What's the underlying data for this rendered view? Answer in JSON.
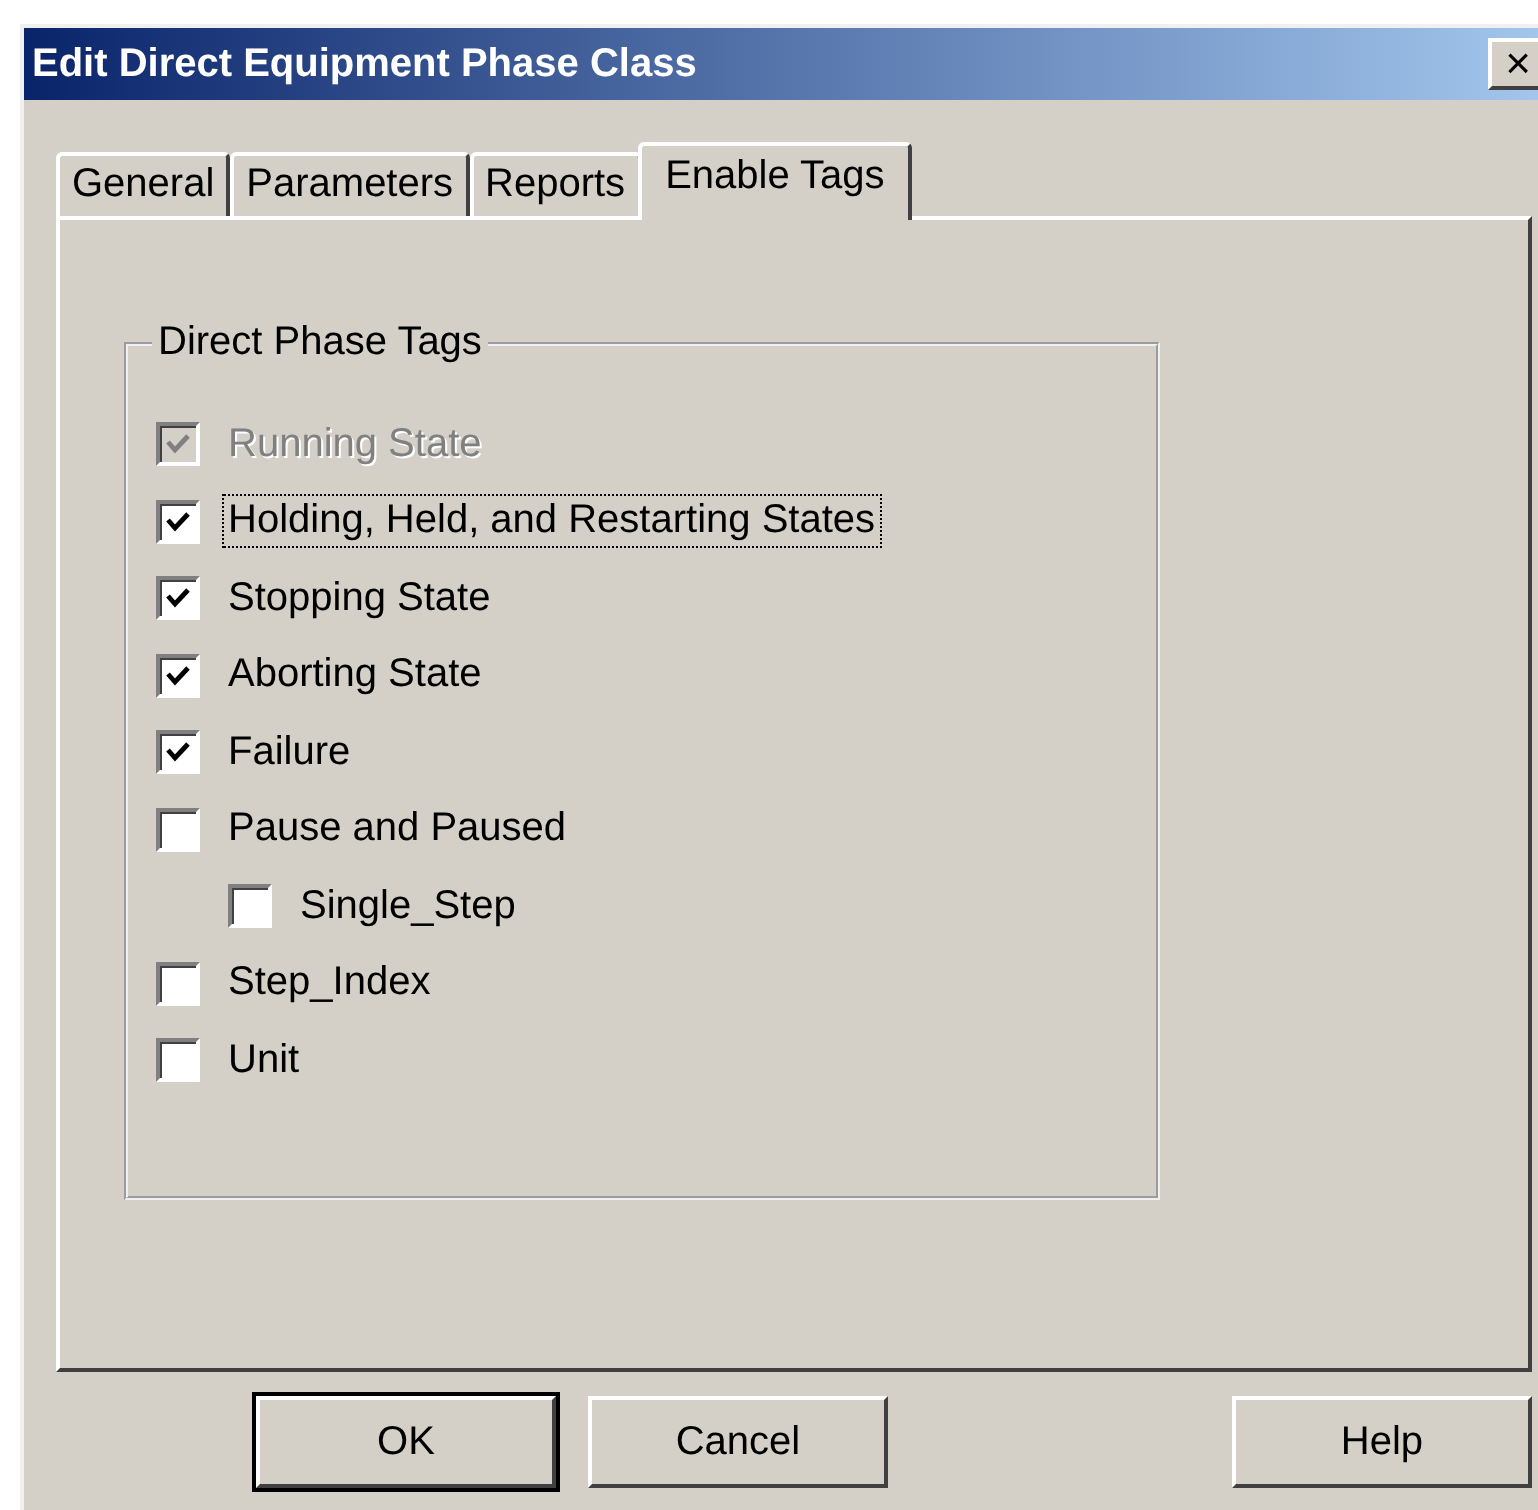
{
  "window": {
    "title": "Edit Direct Equipment Phase Class",
    "close": "×"
  },
  "tabs": [
    {
      "label": "General",
      "selected": false
    },
    {
      "label": "Parameters",
      "selected": false
    },
    {
      "label": "Reports",
      "selected": false
    },
    {
      "label": "Enable Tags",
      "selected": true
    }
  ],
  "group": {
    "title": "Direct Phase Tags",
    "items": [
      {
        "label": "Running State",
        "checked": true,
        "disabled": true,
        "focused": false
      },
      {
        "label": "Holding, Held, and Restarting States",
        "checked": true,
        "disabled": false,
        "focused": true
      },
      {
        "label": "Stopping State",
        "checked": true,
        "disabled": false,
        "focused": false
      },
      {
        "label": "Aborting State",
        "checked": true,
        "disabled": false,
        "focused": false
      },
      {
        "label": "Failure",
        "checked": true,
        "disabled": false,
        "focused": false
      },
      {
        "label": "Pause and Paused",
        "checked": false,
        "disabled": false,
        "focused": false,
        "children": [
          {
            "label": "Single_Step",
            "checked": false,
            "disabled": false,
            "focused": false
          }
        ]
      },
      {
        "label": "Step_Index",
        "checked": false,
        "disabled": false,
        "focused": false
      },
      {
        "label": "Unit",
        "checked": false,
        "disabled": false,
        "focused": false
      }
    ]
  },
  "buttons": [
    {
      "label": "OK",
      "default": true
    },
    {
      "label": "Cancel",
      "default": false
    },
    {
      "label": "Help",
      "default": false
    }
  ]
}
